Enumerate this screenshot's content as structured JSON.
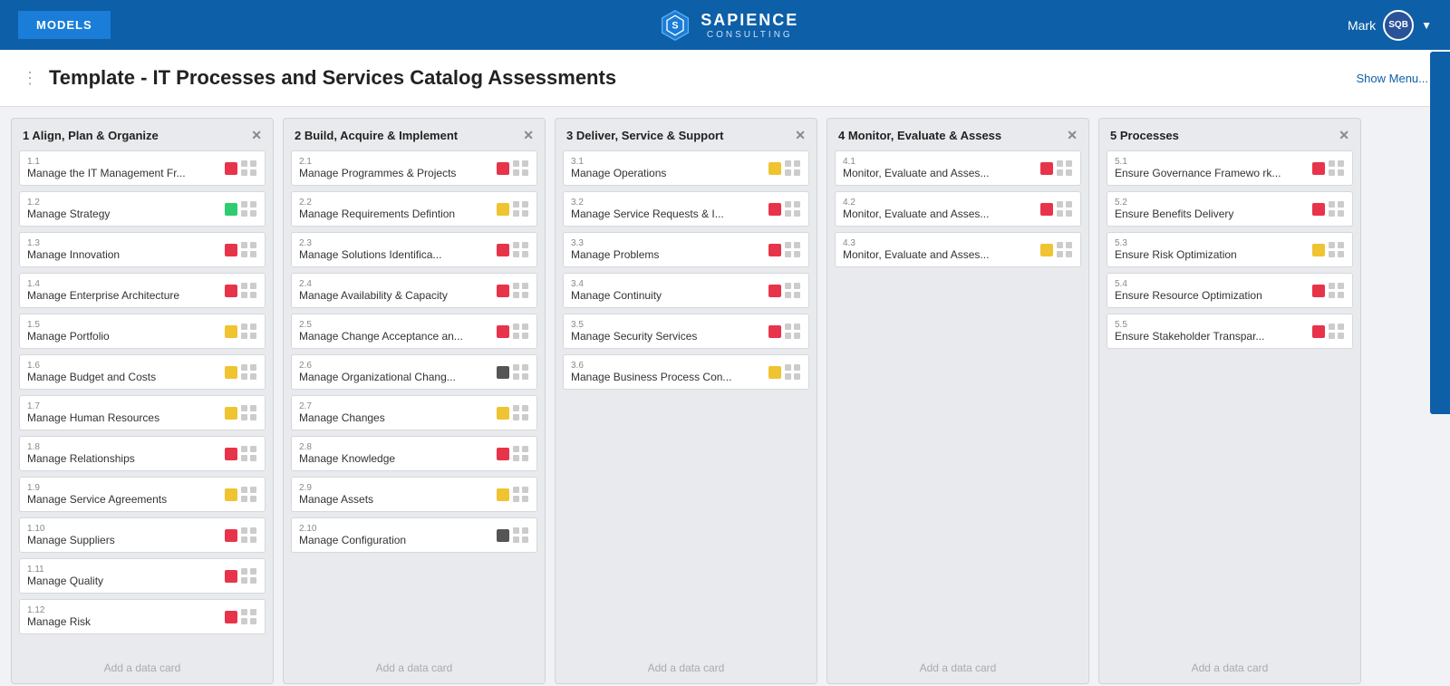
{
  "header": {
    "models_btn": "MODELS",
    "logo_text": "SAPIENCE",
    "logo_sub": "CONSULTING",
    "user_name": "Mark",
    "user_initials": "SQB"
  },
  "page": {
    "title": "Template - IT Processes and Services Catalog Assessments",
    "show_menu": "Show Menu..."
  },
  "columns": [
    {
      "id": "col1",
      "title": "1 Align, Plan & Organize",
      "items": [
        {
          "number": "1.1",
          "title": "Manage the IT Management Fr...",
          "color": "red"
        },
        {
          "number": "1.2",
          "title": "Manage Strategy",
          "color": "green"
        },
        {
          "number": "1.3",
          "title": "Manage Innovation",
          "color": "red"
        },
        {
          "number": "1.4",
          "title": "Manage Enterprise Architecture",
          "color": "red"
        },
        {
          "number": "1.5",
          "title": "Manage Portfolio",
          "color": "yellow"
        },
        {
          "number": "1.6",
          "title": "Manage Budget and Costs",
          "color": "yellow"
        },
        {
          "number": "1.7",
          "title": "Manage Human Resources",
          "color": "yellow"
        },
        {
          "number": "1.8",
          "title": "Manage Relationships",
          "color": "red"
        },
        {
          "number": "1.9",
          "title": "Manage Service Agreements",
          "color": "yellow"
        },
        {
          "number": "1.10",
          "title": "Manage Suppliers",
          "color": "red"
        },
        {
          "number": "1.11",
          "title": "Manage Quality",
          "color": "red"
        },
        {
          "number": "1.12",
          "title": "Manage Risk",
          "color": "red"
        }
      ],
      "add_label": "Add a data card"
    },
    {
      "id": "col2",
      "title": "2 Build, Acquire & Implement",
      "items": [
        {
          "number": "2.1",
          "title": "Manage Programmes & Projects",
          "color": "red"
        },
        {
          "number": "2.2",
          "title": "Manage Requirements Defintion",
          "color": "yellow"
        },
        {
          "number": "2.3",
          "title": "Manage Solutions Identifica...",
          "color": "red"
        },
        {
          "number": "2.4",
          "title": "Manage Availability & Capacity",
          "color": "red"
        },
        {
          "number": "2.5",
          "title": "Manage Change Acceptance an...",
          "color": "red"
        },
        {
          "number": "2.6",
          "title": "Manage Organizational Chang...",
          "color": "dark-gray"
        },
        {
          "number": "2.7",
          "title": "Manage Changes",
          "color": "yellow"
        },
        {
          "number": "2.8",
          "title": "Manage Knowledge",
          "color": "red"
        },
        {
          "number": "2.9",
          "title": "Manage Assets",
          "color": "yellow"
        },
        {
          "number": "2.10",
          "title": "Manage Configuration",
          "color": "dark-gray"
        }
      ],
      "add_label": "Add a data card"
    },
    {
      "id": "col3",
      "title": "3 Deliver, Service & Support",
      "items": [
        {
          "number": "3.1",
          "title": "Manage Operations",
          "color": "yellow"
        },
        {
          "number": "3.2",
          "title": "Manage Service Requests & I...",
          "color": "red"
        },
        {
          "number": "3.3",
          "title": "Manage Problems",
          "color": "red"
        },
        {
          "number": "3.4",
          "title": "Manage Continuity",
          "color": "red"
        },
        {
          "number": "3.5",
          "title": "Manage Security Services",
          "color": "red"
        },
        {
          "number": "3.6",
          "title": "Manage Business Process Con...",
          "color": "yellow"
        }
      ],
      "add_label": "Add a data card"
    },
    {
      "id": "col4",
      "title": "4 Monitor, Evaluate & Assess",
      "items": [
        {
          "number": "4.1",
          "title": "Monitor, Evaluate and Asses...",
          "color": "red"
        },
        {
          "number": "4.2",
          "title": "Monitor, Evaluate and Asses...",
          "color": "red"
        },
        {
          "number": "4.3",
          "title": "Monitor, Evaluate and Asses...",
          "color": "yellow"
        }
      ],
      "add_label": "Add a data card"
    },
    {
      "id": "col5",
      "title": "5 Processes",
      "items": [
        {
          "number": "5.1",
          "title": "Ensure Governance Framewo rk...",
          "color": "red"
        },
        {
          "number": "5.2",
          "title": "Ensure Benefits Delivery",
          "color": "red"
        },
        {
          "number": "5.3",
          "title": "Ensure Risk Optimization",
          "color": "yellow"
        },
        {
          "number": "5.4",
          "title": "Ensure Resource Optimization",
          "color": "red"
        },
        {
          "number": "5.5",
          "title": "Ensure Stakeholder Transpar...",
          "color": "red"
        }
      ],
      "add_label": "Add a data card"
    }
  ]
}
